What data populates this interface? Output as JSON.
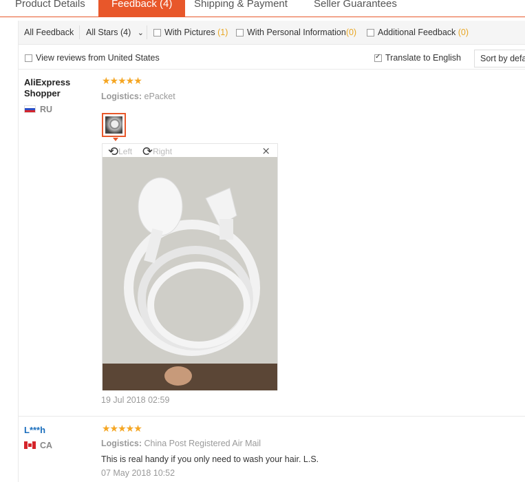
{
  "tabs": [
    {
      "label": "Product Details"
    },
    {
      "label": "Feedback (4)"
    },
    {
      "label": "Shipping & Payment"
    },
    {
      "label": "Seller Guarantees"
    }
  ],
  "filters": {
    "all_feedback": "All Feedback",
    "all_stars": "All Stars (4)",
    "with_pictures": "With Pictures",
    "with_pictures_count": "(1)",
    "with_personal_info": "With Personal Information",
    "with_personal_info_count": "(0)",
    "additional_feedback": "Additional Feedback",
    "additional_feedback_count": "(0)",
    "view_from_us": "View reviews from United States",
    "translate": "Translate to English",
    "translate_checked": true,
    "sort_label": "Sort by default"
  },
  "reviews": [
    {
      "user": "AliExpress Shopper",
      "country": "RU",
      "stars": "★★★★★",
      "logistics_label": "Logistics:",
      "logistics_value": "ePacket",
      "viewer_left": "Left",
      "viewer_right": "Right",
      "date": "19 Jul 2018 02:59"
    },
    {
      "user": "L***h",
      "country": "CA",
      "stars": "★★★★★",
      "logistics_label": "Logistics:",
      "logistics_value": "China Post Registered Air Mail",
      "text": "This is real handy if you only need to wash your hair. L.S.",
      "date": "07 May 2018 10:52"
    }
  ],
  "icons": {
    "close": "×",
    "rotate_left": "⟲",
    "rotate_right": "⟳",
    "chevron": "⌄"
  },
  "colors": {
    "accent": "#e8572a",
    "stars": "#f5a623",
    "link": "#1a6ebd"
  }
}
